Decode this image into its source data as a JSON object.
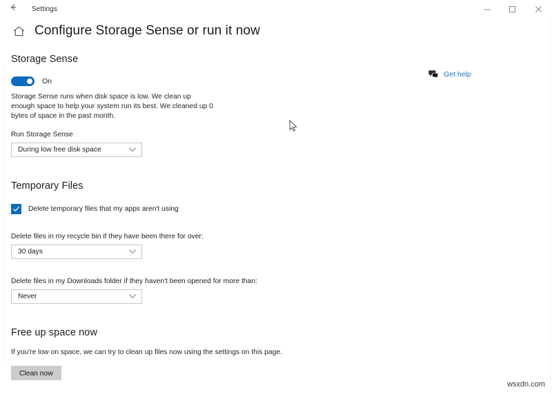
{
  "window": {
    "title": "Settings",
    "back_icon": "back-arrow-icon",
    "controls": [
      {
        "name": "minimize-button",
        "glyph": "minimize-icon"
      },
      {
        "name": "maximize-button",
        "glyph": "maximize-icon"
      },
      {
        "name": "close-button",
        "glyph": "close-icon"
      }
    ]
  },
  "header": {
    "home_icon": "home-icon",
    "title": "Configure Storage Sense or run it now"
  },
  "get_help": {
    "icon": "chat-bubble-icon",
    "label": "Get help",
    "color": "#1a6fc4"
  },
  "storage_sense": {
    "section_title": "Storage Sense",
    "toggle": {
      "state_label": "On",
      "on": true,
      "accent": "#0d6bbd"
    },
    "description": "Storage Sense runs when disk space is low. We clean up enough space to help your system run its best. We cleaned up 0 bytes of space in the past month.",
    "run_label": "Run Storage Sense",
    "run_value": "During low free disk space"
  },
  "temporary_files": {
    "section_title": "Temporary Files",
    "checkbox": {
      "label": "Delete temporary files that my apps aren't using",
      "checked": true,
      "accent": "#0d6bbd"
    },
    "recycle_label": "Delete files in my recycle bin if they have been there for over:",
    "recycle_value": "30 days",
    "downloads_label": "Delete files in my Downloads folder if they haven't been opened for more than:",
    "downloads_value": "Never"
  },
  "free_up_space": {
    "section_title": "Free up space now",
    "description": "If you're low on space, we can try to clean up files now using the settings on this page.",
    "button_label": "Clean now"
  },
  "watermark": "wsxdn.com"
}
